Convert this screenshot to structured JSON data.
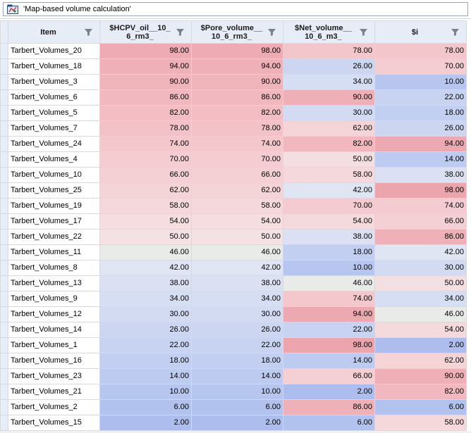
{
  "window": {
    "title": "'Map-based volume calculation'",
    "icon": "map-volume-icon"
  },
  "table": {
    "columns": [
      "Item",
      "$HCPV_oil__10_6_rm3_",
      "$Pore_volume__10_6_rm3_",
      "$Net_volume__10_6_m3_",
      "$i"
    ],
    "column_display": [
      "Item",
      "$HCPV_oil__10_\n6_rm3_",
      "$Pore_volume__\n10_6_rm3_",
      "$Net_volume__\n10_6_m3_",
      "$i"
    ],
    "rows": [
      {
        "item": "Tarbert_Volumes_20",
        "v": [
          "98.00",
          "98.00",
          "78.00",
          "78.00"
        ],
        "c": [
          "#eeabb3",
          "#eeabb3",
          "#f2c6cb",
          "#f2c6cb"
        ]
      },
      {
        "item": "Tarbert_Volumes_18",
        "v": [
          "94.00",
          "94.00",
          "26.00",
          "70.00"
        ],
        "c": [
          "#efb0b7",
          "#efb0b7",
          "#ccd6f0",
          "#f3cdd1"
        ]
      },
      {
        "item": "Tarbert_Volumes_3",
        "v": [
          "90.00",
          "90.00",
          "34.00",
          "10.00"
        ],
        "c": [
          "#f0b4bb",
          "#f0b4bb",
          "#d6def3",
          "#b7c6ef"
        ]
      },
      {
        "item": "Tarbert_Volumes_6",
        "v": [
          "86.00",
          "86.00",
          "90.00",
          "22.00"
        ],
        "c": [
          "#f1b9bf",
          "#f1b9bf",
          "#efafb6",
          "#c7d3f1"
        ]
      },
      {
        "item": "Tarbert_Volumes_5",
        "v": [
          "82.00",
          "82.00",
          "30.00",
          "18.00"
        ],
        "c": [
          "#f2bec4",
          "#f2bec4",
          "#d2dbf2",
          "#c2cff0"
        ]
      },
      {
        "item": "Tarbert_Volumes_7",
        "v": [
          "78.00",
          "78.00",
          "62.00",
          "26.00"
        ],
        "c": [
          "#f2c2c8",
          "#f2c2c8",
          "#f5d4d8",
          "#ccd6f0"
        ]
      },
      {
        "item": "Tarbert_Volumes_24",
        "v": [
          "74.00",
          "74.00",
          "82.00",
          "94.00"
        ],
        "c": [
          "#f3c7cc",
          "#f3c7cc",
          "#f1b9bf",
          "#eda9b1"
        ]
      },
      {
        "item": "Tarbert_Volumes_4",
        "v": [
          "70.00",
          "70.00",
          "50.00",
          "14.00"
        ],
        "c": [
          "#f4ccd1",
          "#f4ccd1",
          "#f3dfe2",
          "#bdcbf0"
        ]
      },
      {
        "item": "Tarbert_Volumes_10",
        "v": [
          "66.00",
          "66.00",
          "58.00",
          "38.00"
        ],
        "c": [
          "#f4d0d4",
          "#f4d0d4",
          "#f5d8db",
          "#dbe1f3"
        ]
      },
      {
        "item": "Tarbert_Volumes_25",
        "v": [
          "62.00",
          "62.00",
          "42.00",
          "98.00"
        ],
        "c": [
          "#f5d4d8",
          "#f5d4d8",
          "#e0e5f4",
          "#eca4ad"
        ]
      },
      {
        "item": "Tarbert_Volumes_19",
        "v": [
          "58.00",
          "58.00",
          "70.00",
          "74.00"
        ],
        "c": [
          "#f5d8dc",
          "#f5d8dc",
          "#f3cbd0",
          "#f3cbd0"
        ]
      },
      {
        "item": "Tarbert_Volumes_17",
        "v": [
          "54.00",
          "54.00",
          "54.00",
          "66.00"
        ],
        "c": [
          "#f5dde0",
          "#f5dde0",
          "#f4dadd",
          "#f4d0d4"
        ]
      },
      {
        "item": "Tarbert_Volumes_22",
        "v": [
          "50.00",
          "50.00",
          "38.00",
          "86.00"
        ],
        "c": [
          "#f4e1e3",
          "#f4e1e3",
          "#dbe1f3",
          "#efb1b8"
        ]
      },
      {
        "item": "Tarbert_Volumes_11",
        "v": [
          "46.00",
          "46.00",
          "18.00",
          "42.00"
        ],
        "c": [
          "#e9ebe8",
          "#e9ebe8",
          "#c2cff0",
          "#e0e5f4"
        ]
      },
      {
        "item": "Tarbert_Volumes_8",
        "v": [
          "42.00",
          "42.00",
          "10.00",
          "30.00"
        ],
        "c": [
          "#e0e5f4",
          "#e0e5f4",
          "#b7c6ef",
          "#d2dbf2"
        ]
      },
      {
        "item": "Tarbert_Volumes_13",
        "v": [
          "38.00",
          "38.00",
          "46.00",
          "50.00"
        ],
        "c": [
          "#dbe1f3",
          "#dbe1f3",
          "#e9ebe8",
          "#f3dfe2"
        ]
      },
      {
        "item": "Tarbert_Volumes_9",
        "v": [
          "34.00",
          "34.00",
          "74.00",
          "34.00"
        ],
        "c": [
          "#d6def3",
          "#d6def3",
          "#f3c7cc",
          "#d6def3"
        ]
      },
      {
        "item": "Tarbert_Volumes_12",
        "v": [
          "30.00",
          "30.00",
          "94.00",
          "46.00"
        ],
        "c": [
          "#d2dbf2",
          "#d2dbf2",
          "#eda9b1",
          "#e9ebe8"
        ]
      },
      {
        "item": "Tarbert_Volumes_14",
        "v": [
          "26.00",
          "26.00",
          "22.00",
          "54.00"
        ],
        "c": [
          "#ccd6f0",
          "#ccd6f0",
          "#c7d3f1",
          "#f4dadd"
        ]
      },
      {
        "item": "Tarbert_Volumes_1",
        "v": [
          "22.00",
          "22.00",
          "98.00",
          "2.00"
        ],
        "c": [
          "#c7d3f1",
          "#c7d3f1",
          "#eca4ad",
          "#adbeee"
        ]
      },
      {
        "item": "Tarbert_Volumes_16",
        "v": [
          "18.00",
          "18.00",
          "14.00",
          "62.00"
        ],
        "c": [
          "#c2cff0",
          "#c2cff0",
          "#bdcbf0",
          "#f5d4d8"
        ]
      },
      {
        "item": "Tarbert_Volumes_23",
        "v": [
          "14.00",
          "14.00",
          "66.00",
          "90.00"
        ],
        "c": [
          "#bdcbf0",
          "#bdcbf0",
          "#f4d0d4",
          "#efafb6"
        ]
      },
      {
        "item": "Tarbert_Volumes_21",
        "v": [
          "10.00",
          "10.00",
          "2.00",
          "82.00"
        ],
        "c": [
          "#b7c6ef",
          "#b7c6ef",
          "#adbeee",
          "#f1b9bf"
        ]
      },
      {
        "item": "Tarbert_Volumes_2",
        "v": [
          "6.00",
          "6.00",
          "86.00",
          "6.00"
        ],
        "c": [
          "#b2c2ee",
          "#b2c2ee",
          "#efb1b8",
          "#b2c2ee"
        ]
      },
      {
        "item": "Tarbert_Volumes_15",
        "v": [
          "2.00",
          "2.00",
          "6.00",
          "58.00"
        ],
        "c": [
          "#adbeee",
          "#adbeee",
          "#b2c2ee",
          "#f5d8db"
        ]
      }
    ]
  },
  "colors": {
    "header_bg": "#e6edf7",
    "grid_line": "#d9d9d9",
    "high_value": "#eca4ad",
    "low_value": "#adbeee",
    "mid_value": "#e9ebe8"
  }
}
